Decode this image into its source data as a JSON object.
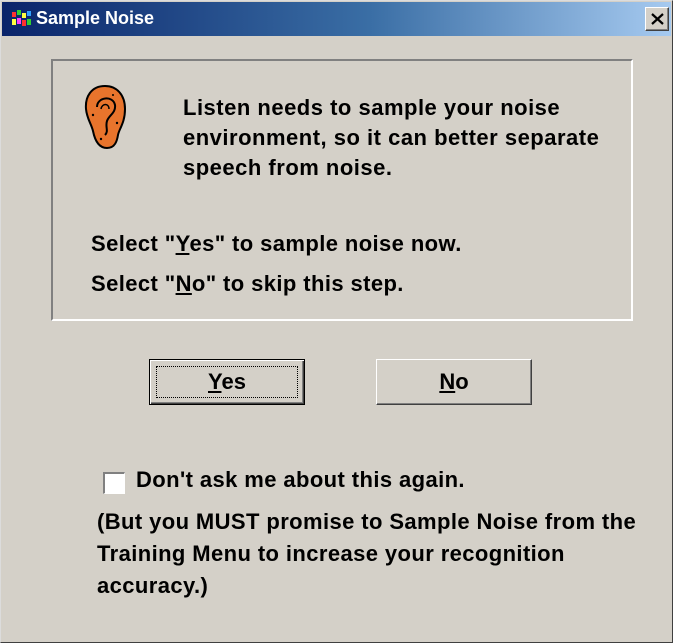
{
  "window": {
    "title": "Sample Noise",
    "app_icon": "app-multicolor-icon",
    "close_icon": "close-icon"
  },
  "info": {
    "icon": "ear-icon",
    "message": "Listen needs to sample your noise environment, so it can better separate speech from noise.",
    "select_yes": {
      "prefix": "Select \"",
      "key": "Y",
      "rest": "es\" to sample noise now."
    },
    "select_no": {
      "prefix": "Select \"",
      "key": "N",
      "rest": "o\" to skip this step."
    }
  },
  "buttons": {
    "yes": {
      "key": "Y",
      "rest": "es"
    },
    "no": {
      "key": "N",
      "rest": "o"
    }
  },
  "option": {
    "checked": false,
    "label": "Don't ask me about this again.",
    "note": "(But you MUST promise to Sample Noise from the Training Menu to increase your recognition accuracy.)"
  },
  "colors": {
    "titlebar_start": "#0a246a",
    "titlebar_end": "#a6caf0",
    "dialog_bg": "#d4d0c8",
    "ear": "#e8742c"
  }
}
